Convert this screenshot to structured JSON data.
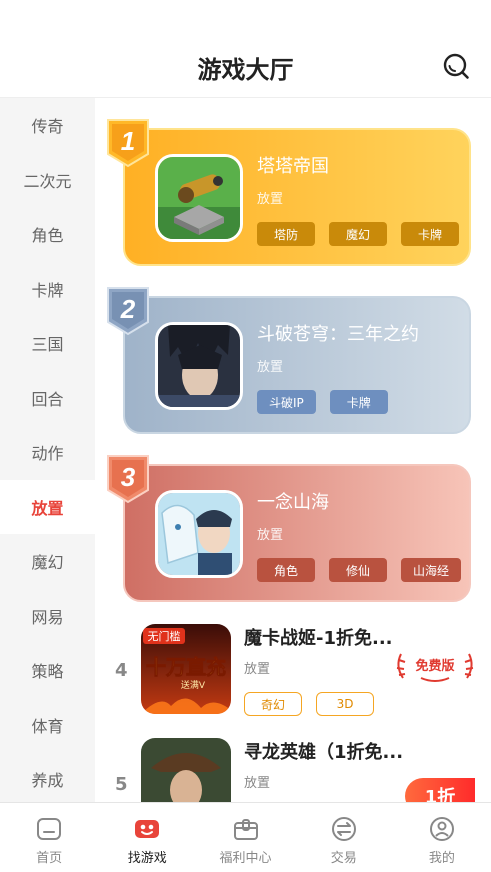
{
  "header": {
    "title": "游戏大厅",
    "search_icon": "search-icon"
  },
  "sidebar": {
    "active_index": 7,
    "items": [
      "传奇",
      "二次元",
      "角色",
      "卡牌",
      "三国",
      "回合",
      "动作",
      "放置",
      "魔幻",
      "网易",
      "策略",
      "体育",
      "养成"
    ]
  },
  "top_games": [
    {
      "rank": "1",
      "name": "塔塔帝国",
      "category": "放置",
      "tags": [
        "塔防",
        "魔幻",
        "卡牌"
      ]
    },
    {
      "rank": "2",
      "name": "斗破苍穹：三年之约",
      "category": "放置",
      "tags": [
        "斗破IP",
        "卡牌"
      ]
    },
    {
      "rank": "3",
      "name": "一念山海",
      "category": "放置",
      "tags": [
        "角色",
        "修仙",
        "山海经"
      ]
    }
  ],
  "list_games": [
    {
      "rank": "4",
      "name": "魔卡战姬-1折免...",
      "category": "放置",
      "tags": [
        "奇幻",
        "3D"
      ],
      "badge": "免费版",
      "icon_text_top": "无门槛",
      "icon_text_mid": "十万直充",
      "icon_text_sub": "送满V"
    },
    {
      "rank": "5",
      "name": "寻龙英雄（1折免...",
      "category": "放置",
      "tags": [],
      "discount": "1折"
    }
  ],
  "bottom_nav": {
    "active_index": 1,
    "items": [
      {
        "label": "首页",
        "icon": "home-icon"
      },
      {
        "label": "找游戏",
        "icon": "gamepad-icon"
      },
      {
        "label": "福利中心",
        "icon": "gift-box-icon"
      },
      {
        "label": "交易",
        "icon": "exchange-icon"
      },
      {
        "label": "我的",
        "icon": "user-icon"
      }
    ]
  },
  "colors": {
    "accent": "#e8443a",
    "gold": "#ffb024",
    "silver": "#9fb3c9",
    "bronze": "#cf6f64"
  }
}
